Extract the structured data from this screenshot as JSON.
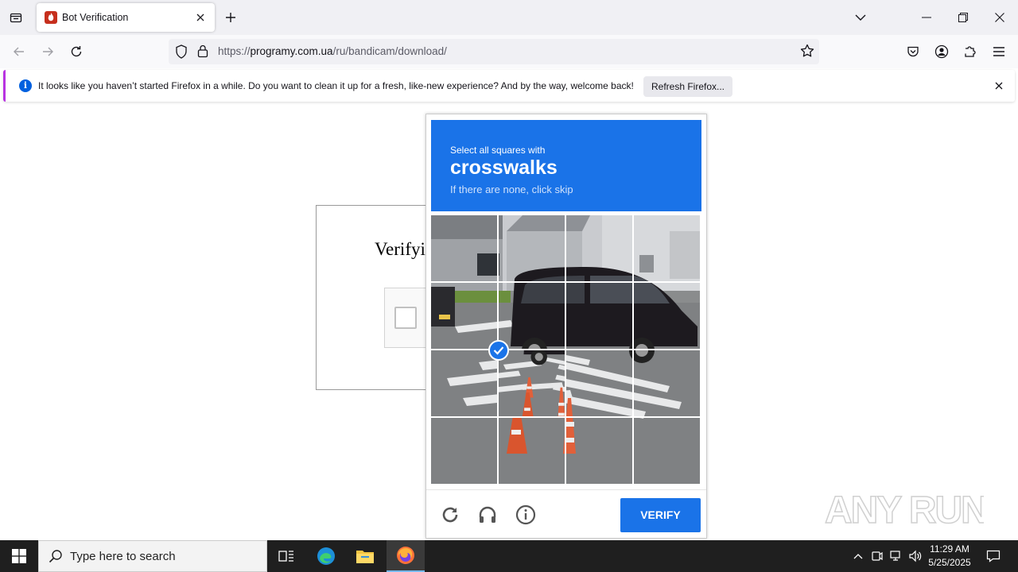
{
  "browser": {
    "tab_title": "Bot Verification",
    "url_prefix": "https://",
    "url_domain": "programy.com.ua",
    "url_path": "/ru/bandicam/download/"
  },
  "notification": {
    "message": "It looks like you haven’t started Firefox in a while. Do you want to clean it up for a fresh, like-new experience? And by the way, welcome back!",
    "button_label": "Refresh Firefox..."
  },
  "page": {
    "heading": "Verifyi"
  },
  "challenge": {
    "instruction": "Select all squares with",
    "target": "crosswalks",
    "hint": "If there are none, click skip",
    "tiles": [
      {
        "selected": false
      },
      {
        "selected": false
      },
      {
        "selected": false
      },
      {
        "selected": false
      },
      {
        "selected": false
      },
      {
        "selected": false
      },
      {
        "selected": false
      },
      {
        "selected": false
      },
      {
        "selected": false
      },
      {
        "selected": true
      },
      {
        "selected": false
      },
      {
        "selected": false
      },
      {
        "selected": false
      },
      {
        "selected": false
      },
      {
        "selected": false
      },
      {
        "selected": false
      }
    ],
    "verify_label": "VERIFY"
  },
  "watermark": "ANY RUN",
  "taskbar": {
    "search_placeholder": "Type here to search",
    "time": "11:29 AM",
    "date": "5/25/2025"
  },
  "colors": {
    "accent": "#1a73e8",
    "notification_border": "#b833e1"
  }
}
